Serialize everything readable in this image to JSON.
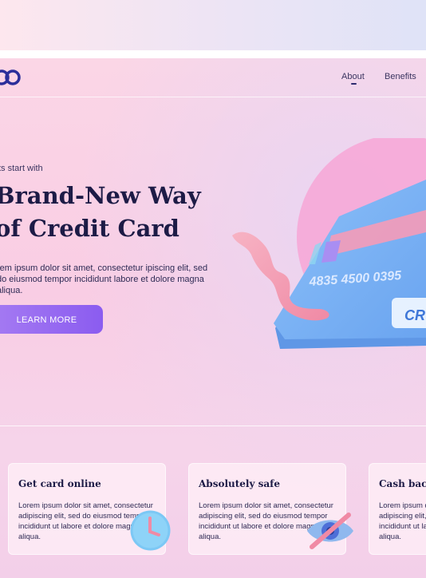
{
  "nav": {
    "links": [
      "About",
      "Benefits"
    ],
    "active_link": "About"
  },
  "hero": {
    "eyebrow": "ts start with",
    "headline_line1": "Brand-New Way",
    "headline_line2": "of Credit Card",
    "description": "rem ipsum dolor sit amet, consectetur ipiscing elit, sed do eiusmod tempor incididunt labore et dolore magna aliqua.",
    "cta_label": "LEARN MORE",
    "card_number": "4835 4500 0395",
    "card_badge": "CR"
  },
  "features": [
    {
      "title": "Get card online",
      "text": "Lorem ipsum dolor sit amet, consectetur adipiscing elit, sed do eiusmod tempor incididunt ut labore et dolore magna aliqua.",
      "icon": "clock-icon"
    },
    {
      "title": "Absolutely safe",
      "text": "Lorem ipsum dolor sit amet, consectetur adipiscing elit, sed do eiusmod tempor incididunt ut labore et dolore magna aliqua.",
      "icon": "eye-off-icon"
    },
    {
      "title": "Cash back",
      "text": "Lorem ipsum dolor sit amet, consectetur adipiscing elit, sed do eiusmod tempor incididunt ut labore et dolore magna aliqua."
    }
  ],
  "colors": {
    "accent": "#8b5cf0",
    "heading": "#1d1b46",
    "card_blue": "#7fb3f5",
    "card_pink_stripe": "#f59bb8",
    "circle_pink": "#f7a6d6"
  }
}
